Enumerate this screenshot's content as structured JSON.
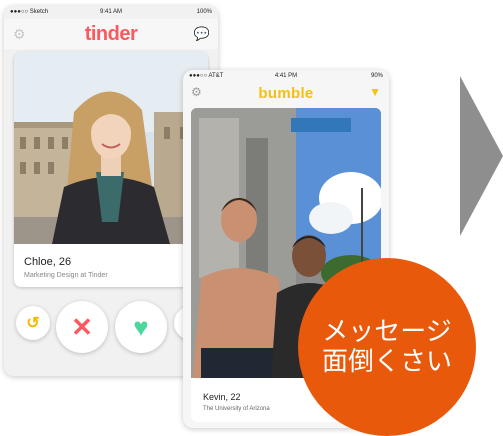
{
  "tinder": {
    "status": {
      "carrier": "●●●○○ Sketch",
      "time": "9:41 AM",
      "battery": "100%"
    },
    "logo": "tinder",
    "profile": {
      "name_age": "Chloe, 26",
      "job": "Marketing Design at Tinder"
    },
    "colors": {
      "brand": "#fa5a5f",
      "nope": "#fa5a5f",
      "like": "#4cd69c",
      "undo": "#f5b800"
    }
  },
  "bumble": {
    "status": {
      "carrier": "●●●○○ AT&T",
      "time": "4:41 PM",
      "battery": "90%"
    },
    "logo": "bumble",
    "profile": {
      "name_age": "Kevin, 22",
      "school": "The University of Arizona"
    },
    "colors": {
      "brand": "#f5c010"
    }
  },
  "overlay": {
    "line1": "メッセージ",
    "line2": "面倒くさい",
    "color": "#e8590c"
  },
  "icons": [
    "gear-icon",
    "chat-bubble-icon",
    "undo-icon",
    "nope-icon",
    "like-icon",
    "superlike-icon",
    "filter-icon",
    "right-arrow-icon"
  ]
}
